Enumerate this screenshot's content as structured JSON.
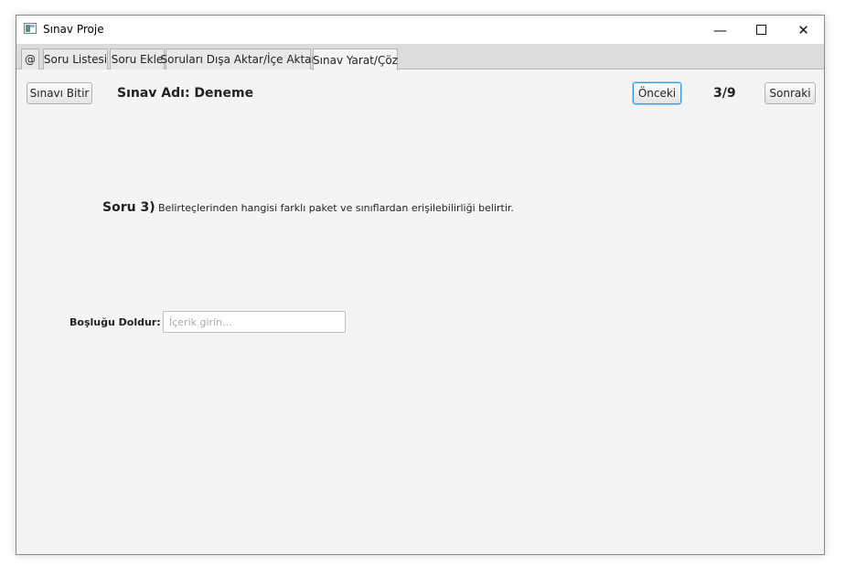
{
  "window": {
    "title": "Sınav Proje",
    "controls": {
      "minimize": "—",
      "close": "✕"
    }
  },
  "tabs": [
    {
      "label": "@"
    },
    {
      "label": "Soru Listesi"
    },
    {
      "label": "Soru Ekle"
    },
    {
      "label": "Soruları Dışa Aktar/İçe Aktar"
    },
    {
      "label": "Sınav Yarat/Çöz",
      "active": true
    }
  ],
  "toolbar": {
    "finish_label": "Sınavı Bitir",
    "exam_name": "Sınav Adı: Deneme",
    "prev_label": "Önceki",
    "counter": "3/9",
    "next_label": "Sonraki"
  },
  "progress": {
    "current": 3,
    "total": 9
  },
  "question": {
    "number_label": "Soru 3)",
    "text": "Belirteçlerinden hangisi farklı paket ve sınıflardan erişilebilirliği belirtir."
  },
  "fill_blank": {
    "label": "Boşluğu Doldur:",
    "placeholder": "İçerik girin...",
    "value": ""
  },
  "colors": {
    "focus_border": "#3a9ad9",
    "window_bg": "#f4f4f4"
  },
  "icons": {
    "app": "app-window-icon",
    "minimize": "minimize-icon",
    "maximize": "maximize-icon",
    "close": "close-icon"
  }
}
